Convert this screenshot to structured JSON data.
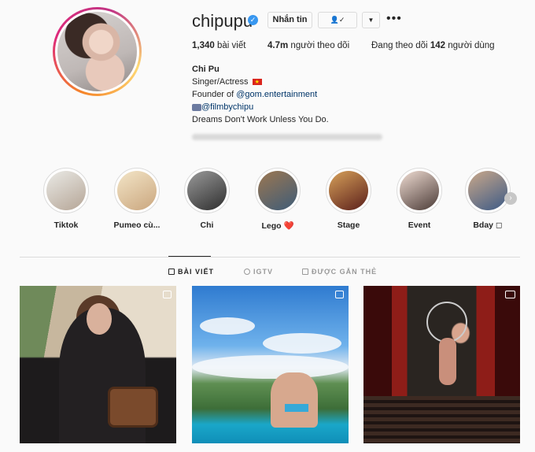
{
  "profile": {
    "username": "chipupu",
    "verified_icon": "verified-badge-icon",
    "message_label": "Nhắn tin",
    "follow_icon": "person-check-icon",
    "more_icon": "chevron-down-icon",
    "options_icon": "more-dots-icon",
    "stats": {
      "posts_count": "1,340",
      "posts_label": "bài viết",
      "followers_count": "4.7m",
      "followers_label": "người theo dõi",
      "following_prefix": "Đang theo dõi",
      "following_count": "142",
      "following_label": "người dùng"
    },
    "bio": {
      "name": "Chi Pu",
      "line1": "Singer/Actress",
      "line2_prefix": "Founder of",
      "line2_link": "@gom.entertainment",
      "line3_link": "@filmbychipu",
      "line4": "Dreams Don't Work Unless You Do."
    }
  },
  "highlights": [
    {
      "label": "Tiktok",
      "color_a": "#eaeae6",
      "color_b": "#b5a596"
    },
    {
      "label": "Pumeo cù...",
      "color_a": "#f3e5c7",
      "color_b": "#caa67e"
    },
    {
      "label": "Chi",
      "color_a": "#9a9a9a",
      "color_b": "#2e2e2e"
    },
    {
      "label": "Lego ❤️",
      "color_a": "#9c7751",
      "color_b": "#3e5c78"
    },
    {
      "label": "Stage",
      "color_a": "#d7a15a",
      "color_b": "#5a1e1a"
    },
    {
      "label": "Event",
      "color_a": "#f0ddd3",
      "color_b": "#4a3a36"
    },
    {
      "label": "Bday ◻",
      "color_a": "#caa88a",
      "color_b": "#3c5a86"
    }
  ],
  "tabs": {
    "posts": "BÀI VIẾT",
    "igtv": "IGTV",
    "tagged": "ĐƯỢC GẮN THẺ"
  },
  "colors": {
    "link": "#003569",
    "verified": "#3897f0",
    "border": "#dbdbdb"
  }
}
